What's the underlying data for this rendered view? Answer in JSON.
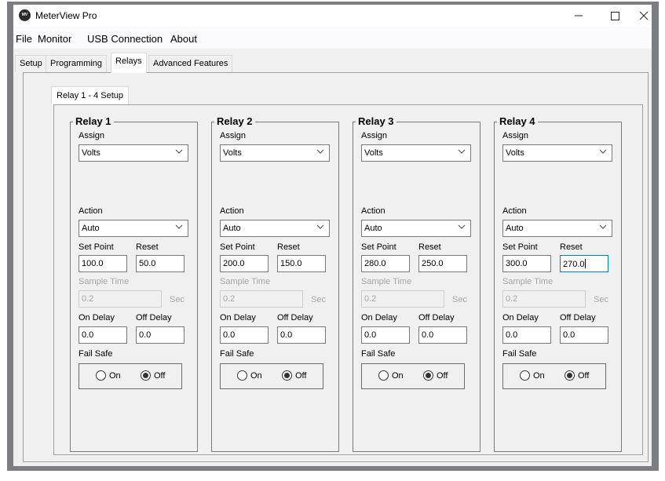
{
  "window": {
    "title": "MeterView Pro",
    "icon": "meterview-logo-icon",
    "controls": {
      "minimize": "–",
      "close": "✕"
    }
  },
  "menu": [
    "File",
    "Monitor",
    "USB Connection",
    "About"
  ],
  "tabs": [
    {
      "label": "Setup",
      "active": false
    },
    {
      "label": "Programming",
      "active": false
    },
    {
      "label": "Relays",
      "active": true
    },
    {
      "label": "Advanced Features",
      "active": false
    }
  ],
  "inner_tab": {
    "label": "Relay 1 - 4 Setup"
  },
  "labels": {
    "assign": "Assign",
    "action": "Action",
    "set_point": "Set Point",
    "reset": "Reset",
    "sample_time": "Sample Time",
    "sec": "Sec",
    "on_delay": "On Delay",
    "off_delay": "Off Delay",
    "fail_safe": "Fail Safe",
    "on": "On",
    "off": "Off"
  },
  "relays": [
    {
      "title": "Relay 1",
      "assign": "Volts",
      "action": "Auto",
      "set_point": "100.0",
      "reset": "50.0",
      "sample_time": "0.2",
      "on_delay": "0.0",
      "off_delay": "0.0",
      "fail_safe": "Off"
    },
    {
      "title": "Relay 2",
      "assign": "Volts",
      "action": "Auto",
      "set_point": "200.0",
      "reset": "150.0",
      "sample_time": "0.2",
      "on_delay": "0.0",
      "off_delay": "0.0",
      "fail_safe": "Off"
    },
    {
      "title": "Relay 3",
      "assign": "Volts",
      "action": "Auto",
      "set_point": "280.0",
      "reset": "250.0",
      "sample_time": "0.2",
      "on_delay": "0.0",
      "off_delay": "0.0",
      "fail_safe": "Off"
    },
    {
      "title": "Relay 4",
      "assign": "Volts",
      "action": "Auto",
      "set_point": "300.0",
      "reset": "270.0",
      "sample_time": "0.2",
      "on_delay": "0.0",
      "off_delay": "0.0",
      "fail_safe": "Off",
      "focused_field": "reset"
    }
  ],
  "colors": {
    "focus": "#0078d7",
    "window_bg": "#f0f0f0",
    "frame": "#7d7e82"
  }
}
